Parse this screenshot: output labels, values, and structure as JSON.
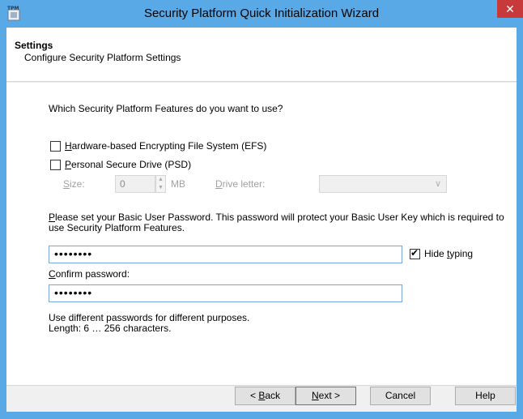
{
  "window": {
    "title": "Security Platform Quick Initialization Wizard",
    "icon": "tpm-chip-icon",
    "icon_text": "TPM",
    "close_symbol": "✕"
  },
  "header": {
    "title": "Settings",
    "subtitle": "Configure Security Platform Settings"
  },
  "features": {
    "question": "Which Security Platform Features do you want to use?",
    "efs": {
      "label_key": "H",
      "label_rest": "ardware-based Encrypting File System (EFS)",
      "checked": false
    },
    "psd": {
      "label_key": "P",
      "label_rest": "ersonal Secure Drive (PSD)",
      "checked": false
    },
    "size": {
      "label_key": "S",
      "label_rest": "ize:",
      "value": "0",
      "unit": "MB"
    },
    "drive_letter": {
      "label_key": "D",
      "label_rest": "rive letter:",
      "value": ""
    }
  },
  "password": {
    "prompt_key": "P",
    "prompt_rest": "lease set your Basic User Password. This password will protect your Basic User Key which is required to use Security Platform Features.",
    "value": "••••••••",
    "hide_typing": {
      "label_rest_before": "Hide ",
      "label_key": "t",
      "label_rest": "yping",
      "checked": true
    },
    "confirm_label_key": "C",
    "confirm_label_rest": "onfirm password:",
    "confirm_value": "••••••••",
    "hint1": "Use different passwords for different purposes.",
    "hint2": "Length: 6 … 256 characters."
  },
  "buttons": {
    "back_prefix": "< ",
    "back_key": "B",
    "back_rest": "ack",
    "next_key": "N",
    "next_rest": "ext >",
    "cancel": "Cancel",
    "help": "Help"
  },
  "colors": {
    "title_bar": "#59a9e6",
    "close_button": "#c7393a",
    "disabled_text": "#a0a0a0"
  }
}
